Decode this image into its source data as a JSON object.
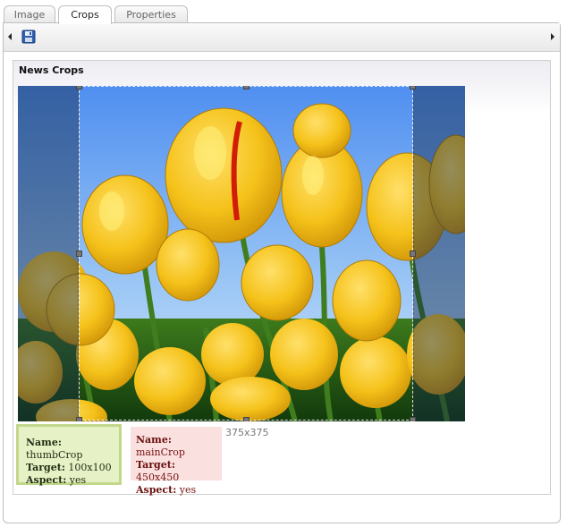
{
  "tabs": [
    {
      "label": "Image",
      "active": false
    },
    {
      "label": "Crops",
      "active": true
    },
    {
      "label": "Properties",
      "active": false
    }
  ],
  "toolbar": {
    "save_icon": "save-icon"
  },
  "section": {
    "title": "News Crops"
  },
  "crop": {
    "dimensions": "375x375"
  },
  "crops": [
    {
      "name_label": "Name:",
      "name": "thumbCrop",
      "target_label": "Target:",
      "target": "100x100",
      "aspect_label": "Aspect:",
      "aspect": "yes",
      "selected": true
    },
    {
      "name_label": "Name:",
      "name": "mainCrop",
      "target_label": "Target:",
      "target": "450x450",
      "aspect_label": "Aspect:",
      "aspect": "yes",
      "selected": false
    }
  ],
  "colors": {
    "selected_card_bg": "#e7f1c6",
    "selected_card_border": "#c3d78b",
    "other_card_bg": "#fbe0e0"
  }
}
